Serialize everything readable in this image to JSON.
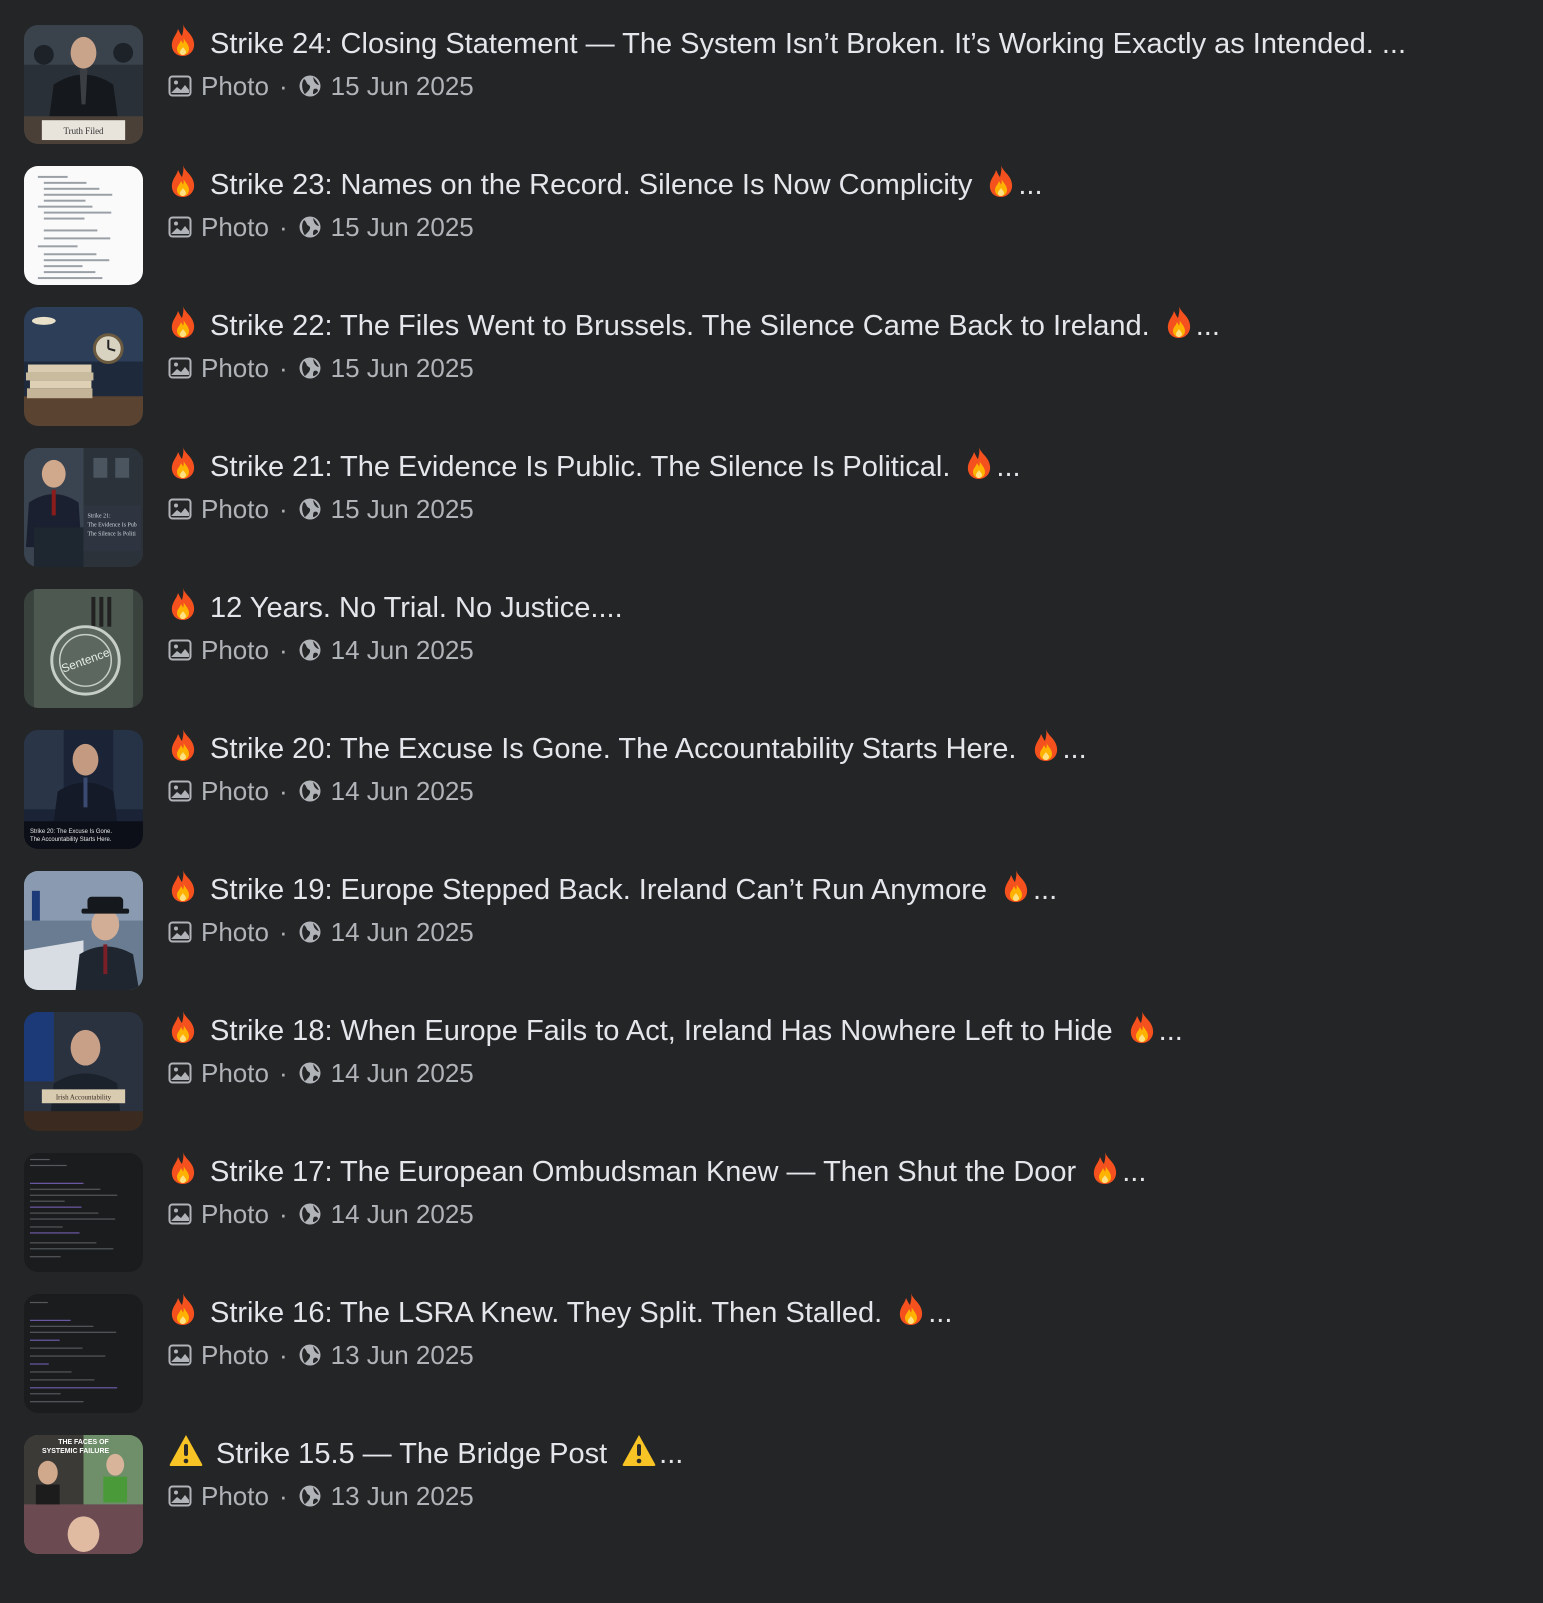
{
  "colors": {
    "background": "#242526",
    "title_text": "#e4e6eb",
    "meta_text": "#b0b3b8"
  },
  "posts": [
    {
      "prefix_icon": "fire-icon",
      "title": "Strike 24: Closing Statement — The System Isn’t Broken. It’s Working Exactly as Intended.",
      "suffix_icon": "",
      "ellipsis": "...",
      "type": "Photo",
      "date": "15 Jun 2025",
      "thumbnail": "man-at-desk-with-paper",
      "thumbnail_caption": "Truth Filed"
    },
    {
      "prefix_icon": "fire-icon",
      "title": "Strike 23: Names on the Record. Silence Is Now Complicity",
      "suffix_icon": "fire-icon",
      "ellipsis": "...",
      "type": "Photo",
      "date": "15 Jun 2025",
      "thumbnail": "document-list",
      "thumbnail_caption": ""
    },
    {
      "prefix_icon": "fire-icon",
      "title": "Strike 22: The Files Went to Brussels. The Silence Came Back to Ireland.",
      "suffix_icon": "fire-icon",
      "ellipsis": "...",
      "type": "Photo",
      "date": "15 Jun 2025",
      "thumbnail": "stacked-files-clock",
      "thumbnail_caption": ""
    },
    {
      "prefix_icon": "fire-icon",
      "title": "Strike 21: The Evidence Is Public. The Silence Is Political.",
      "suffix_icon": "fire-icon",
      "ellipsis": "...",
      "type": "Photo",
      "date": "15 Jun 2025",
      "thumbnail": "man-at-podium",
      "thumbnail_caption": ""
    },
    {
      "prefix_icon": "fire-icon",
      "title": "12 Years. No Trial. No Justice....",
      "suffix_icon": "",
      "ellipsis": "",
      "type": "Photo",
      "date": "14 Jun 2025",
      "thumbnail": "prison-stamp",
      "thumbnail_caption": "Sentence"
    },
    {
      "prefix_icon": "fire-icon",
      "title": "Strike 20: The Excuse Is Gone. The Accountability Starts Here.",
      "suffix_icon": "fire-icon",
      "ellipsis": "...",
      "type": "Photo",
      "date": "14 Jun 2025",
      "thumbnail": "man-in-suit-dark",
      "thumbnail_caption": ""
    },
    {
      "prefix_icon": "fire-icon",
      "title": "Strike 19: Europe Stepped Back. Ireland Can’t Run Anymore",
      "suffix_icon": "fire-icon",
      "ellipsis": "...",
      "type": "Photo",
      "date": "14 Jun 2025",
      "thumbnail": "man-with-hat-papers",
      "thumbnail_caption": ""
    },
    {
      "prefix_icon": "fire-icon",
      "title": "Strike 18: When Europe Fails to Act, Ireland Has Nowhere Left to Hide",
      "suffix_icon": "fire-icon",
      "ellipsis": "...",
      "type": "Photo",
      "date": "14 Jun 2025",
      "thumbnail": "man-with-nameplate",
      "thumbnail_caption": "Irish Accountability"
    },
    {
      "prefix_icon": "fire-icon",
      "title": "Strike 17: The European Ombudsman Knew — Then Shut the Door",
      "suffix_icon": "fire-icon",
      "ellipsis": "...",
      "type": "Photo",
      "date": "14 Jun 2025",
      "thumbnail": "dark-document",
      "thumbnail_caption": ""
    },
    {
      "prefix_icon": "fire-icon",
      "title": "Strike 16: The LSRA Knew. They Split. Then Stalled.",
      "suffix_icon": "fire-icon",
      "ellipsis": "...",
      "type": "Photo",
      "date": "13 Jun 2025",
      "thumbnail": "dark-document-2",
      "thumbnail_caption": ""
    },
    {
      "prefix_icon": "warning-icon",
      "title": "Strike 15.5 — The Bridge Post",
      "suffix_icon": "warning-icon",
      "ellipsis": "...",
      "type": "Photo",
      "date": "13 Jun 2025",
      "thumbnail": "collage-faces",
      "thumbnail_caption": "THE FACES OF SYSTEMIC FAILURE"
    }
  ]
}
